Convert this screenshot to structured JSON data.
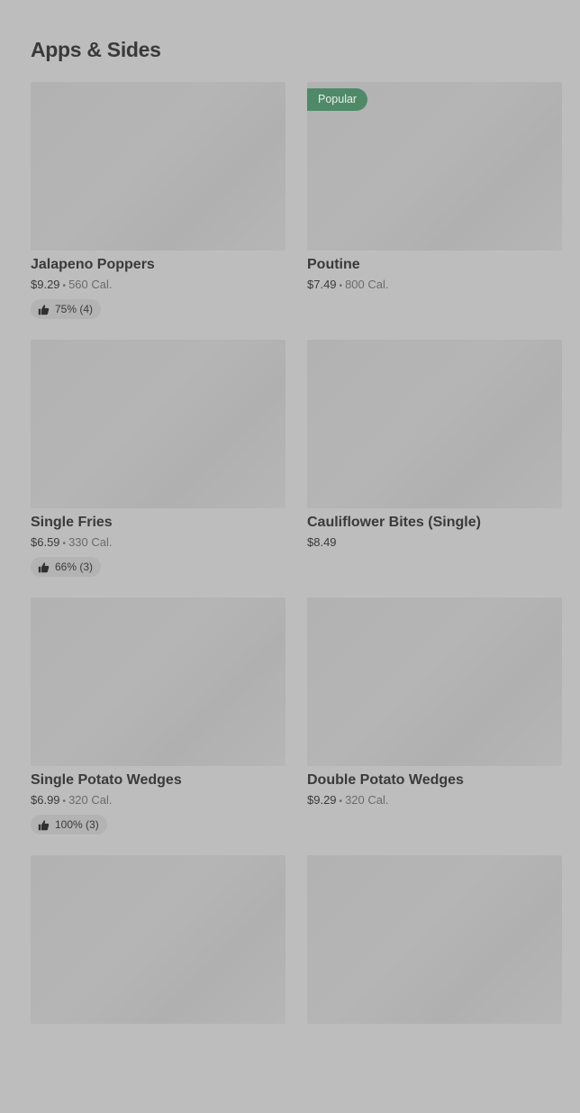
{
  "section": {
    "title": "Apps & Sides"
  },
  "items": [
    {
      "name": "Jalapeno Poppers",
      "price": "$9.29",
      "calories": "560 Cal.",
      "rating": "75% (4)",
      "badge": ""
    },
    {
      "name": "Poutine",
      "price": "$7.49",
      "calories": "800 Cal.",
      "rating": "",
      "badge": "Popular"
    },
    {
      "name": "Single Fries",
      "price": "$6.59",
      "calories": "330 Cal.",
      "rating": "66% (3)",
      "badge": ""
    },
    {
      "name": "Cauliflower Bites (Single)",
      "price": "$8.49",
      "calories": "",
      "rating": "",
      "badge": ""
    },
    {
      "name": "Single Potato Wedges",
      "price": "$6.99",
      "calories": "320 Cal.",
      "rating": "100% (3)",
      "badge": ""
    },
    {
      "name": "Double Potato Wedges",
      "price": "$9.29",
      "calories": "320 Cal.",
      "rating": "",
      "badge": ""
    },
    {
      "name": "",
      "price": "",
      "calories": "",
      "rating": "",
      "badge": ""
    },
    {
      "name": "",
      "price": "",
      "calories": "",
      "rating": "",
      "badge": ""
    }
  ],
  "colors": {
    "background": "#bdbdbd",
    "badge": "#4f8a68",
    "text": "#3a3a3a"
  },
  "icons": {
    "rating": "thumbs-up-icon"
  }
}
